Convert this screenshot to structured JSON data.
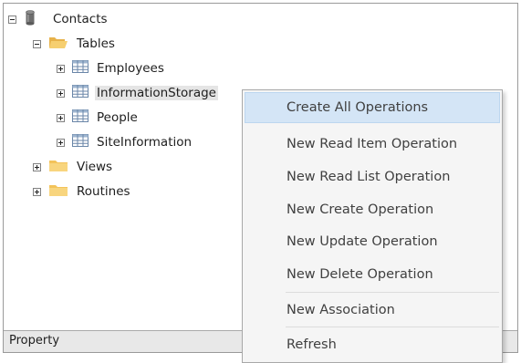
{
  "tree": {
    "root": {
      "label": "Contacts",
      "icon": "database-icon"
    },
    "tables_folder": {
      "label": "Tables",
      "icon": "folder-open-icon"
    },
    "tables": [
      {
        "label": "Employees",
        "icon": "table-icon"
      },
      {
        "label": "InformationStorage",
        "icon": "table-icon",
        "selected": true
      },
      {
        "label": "People",
        "icon": "table-icon"
      },
      {
        "label": "SiteInformation",
        "icon": "table-icon"
      }
    ],
    "views_folder": {
      "label": "Views",
      "icon": "folder-icon"
    },
    "routines_folder": {
      "label": "Routines",
      "icon": "folder-icon"
    }
  },
  "statusbar": {
    "label": "Property"
  },
  "context_menu": {
    "items": [
      {
        "label": "Create All Operations",
        "highlighted": true
      },
      {
        "label": "New Read Item Operation"
      },
      {
        "label": "New Read List Operation"
      },
      {
        "label": "New Create Operation"
      },
      {
        "label": "New Update Operation"
      },
      {
        "label": "New Delete Operation"
      },
      {
        "label": "New Association"
      },
      {
        "label": "Refresh"
      }
    ]
  },
  "colors": {
    "menu_highlight": "#d4e5f6",
    "menu_background": "#f5f5f5",
    "folder": "#f3c35a",
    "selection": "#e5e5e5"
  }
}
